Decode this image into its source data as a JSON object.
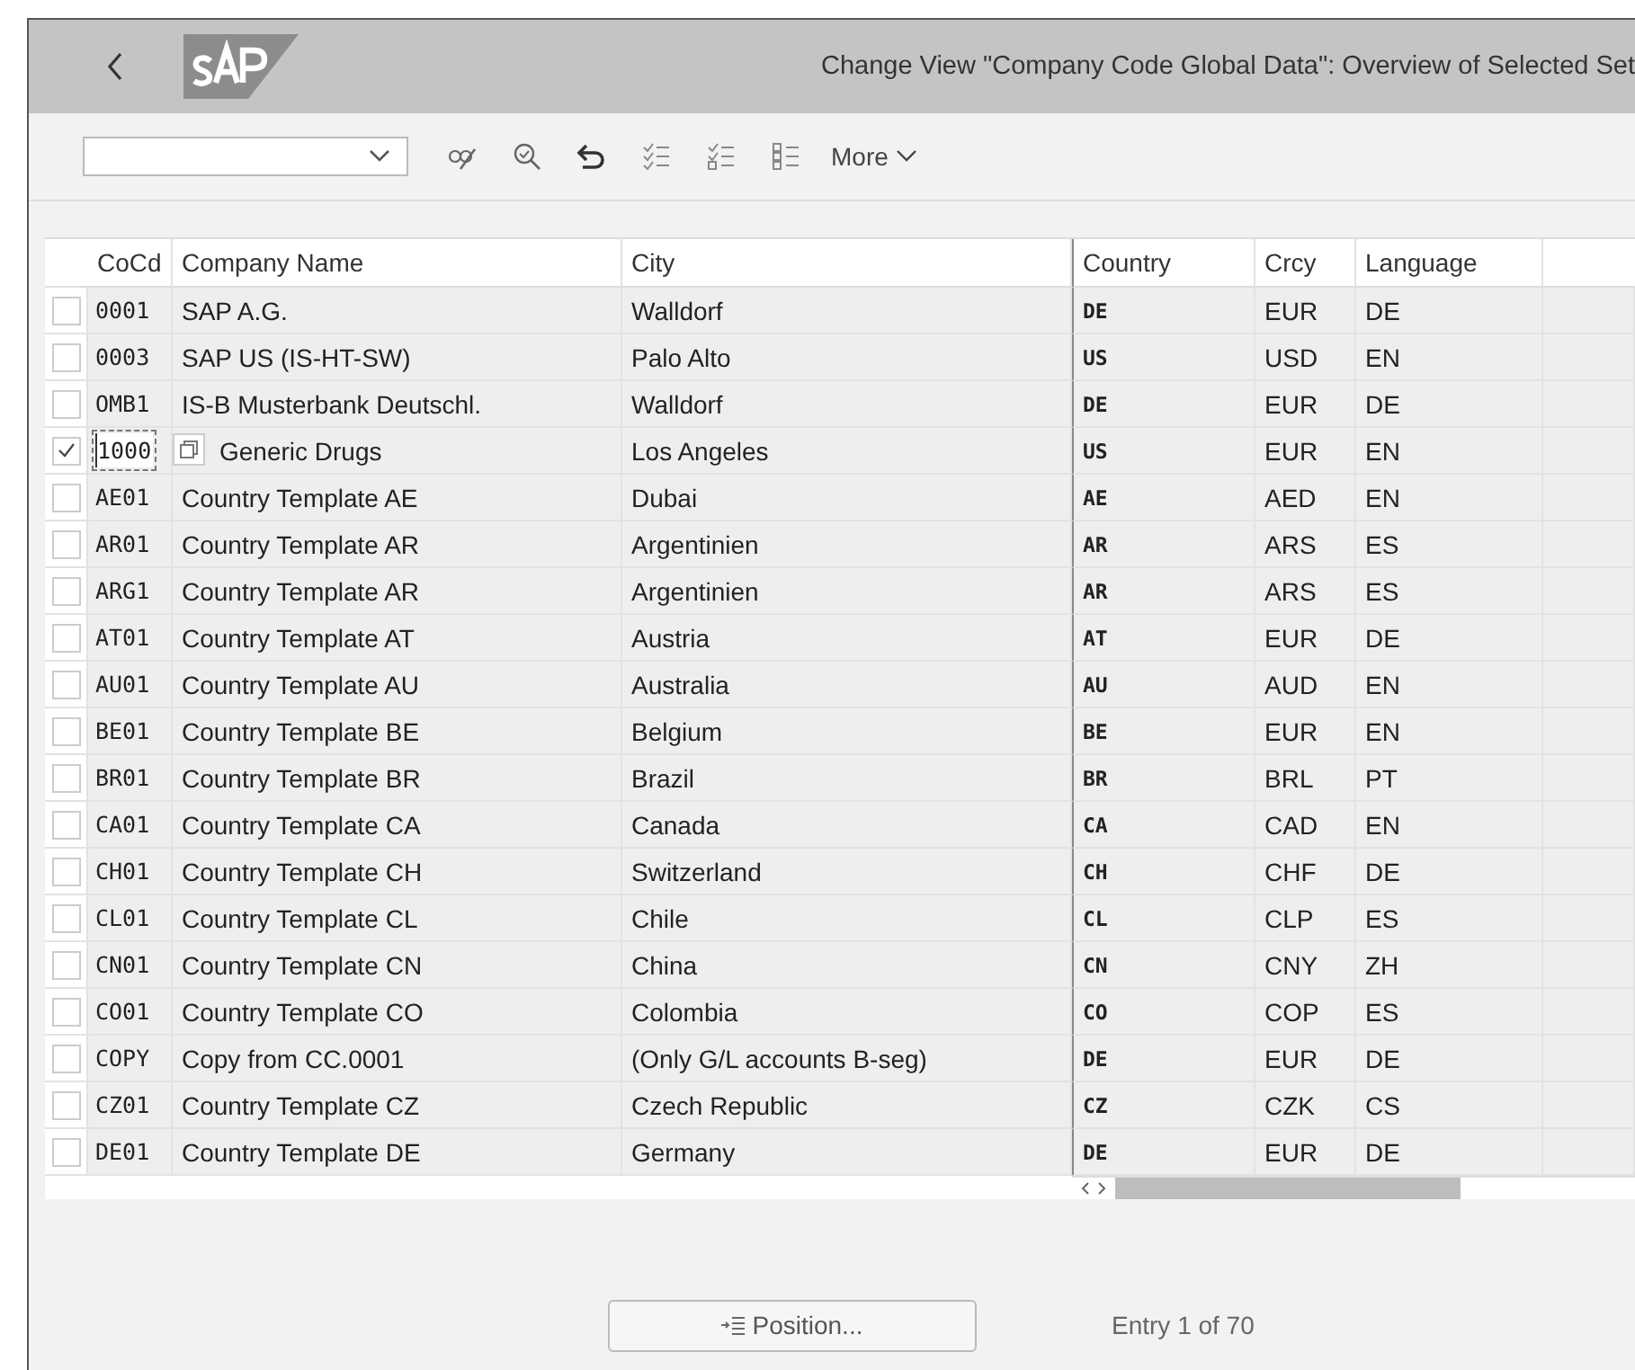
{
  "header": {
    "title": "Change View \"Company Code Global Data\": Overview of Selected Set"
  },
  "toolbar": {
    "more": "More"
  },
  "table": {
    "columns": [
      "CoCd",
      "Company Name",
      "City",
      "Country",
      "Crcy",
      "Language"
    ],
    "rows": [
      {
        "selected": false,
        "focused": false,
        "cells": [
          "0001",
          "SAP A.G.",
          "Walldorf",
          "DE",
          "EUR",
          "DE"
        ]
      },
      {
        "selected": false,
        "focused": false,
        "cells": [
          "0003",
          "SAP US (IS-HT-SW)",
          "Palo Alto",
          "US",
          "USD",
          "EN"
        ]
      },
      {
        "selected": false,
        "focused": false,
        "cells": [
          "OMB1",
          "IS-B Musterbank Deutschl.",
          "Walldorf",
          "DE",
          "EUR",
          "DE"
        ]
      },
      {
        "selected": true,
        "focused": true,
        "cells": [
          "1000",
          "Generic Drugs",
          "Los Angeles",
          "US",
          "EUR",
          "EN"
        ]
      },
      {
        "selected": false,
        "focused": false,
        "cells": [
          "AE01",
          "Country Template AE",
          "Dubai",
          "AE",
          "AED",
          "EN"
        ]
      },
      {
        "selected": false,
        "focused": false,
        "cells": [
          "AR01",
          "Country Template AR",
          "Argentinien",
          "AR",
          "ARS",
          "ES"
        ]
      },
      {
        "selected": false,
        "focused": false,
        "cells": [
          "ARG1",
          "Country Template AR",
          "Argentinien",
          "AR",
          "ARS",
          "ES"
        ]
      },
      {
        "selected": false,
        "focused": false,
        "cells": [
          "AT01",
          "Country Template AT",
          "Austria",
          "AT",
          "EUR",
          "DE"
        ]
      },
      {
        "selected": false,
        "focused": false,
        "cells": [
          "AU01",
          "Country Template AU",
          "Australia",
          "AU",
          "AUD",
          "EN"
        ]
      },
      {
        "selected": false,
        "focused": false,
        "cells": [
          "BE01",
          "Country Template BE",
          "Belgium",
          "BE",
          "EUR",
          "EN"
        ]
      },
      {
        "selected": false,
        "focused": false,
        "cells": [
          "BR01",
          "Country Template BR",
          "Brazil",
          "BR",
          "BRL",
          "PT"
        ]
      },
      {
        "selected": false,
        "focused": false,
        "cells": [
          "CA01",
          "Country Template CA",
          "Canada",
          "CA",
          "CAD",
          "EN"
        ]
      },
      {
        "selected": false,
        "focused": false,
        "cells": [
          "CH01",
          "Country Template CH",
          "Switzerland",
          "CH",
          "CHF",
          "DE"
        ]
      },
      {
        "selected": false,
        "focused": false,
        "cells": [
          "CL01",
          "Country Template CL",
          "Chile",
          "CL",
          "CLP",
          "ES"
        ]
      },
      {
        "selected": false,
        "focused": false,
        "cells": [
          "CN01",
          "Country Template CN",
          "China",
          "CN",
          "CNY",
          "ZH"
        ]
      },
      {
        "selected": false,
        "focused": false,
        "cells": [
          "CO01",
          "Country Template CO",
          "Colombia",
          "CO",
          "COP",
          "ES"
        ]
      },
      {
        "selected": false,
        "focused": false,
        "cells": [
          "COPY",
          "Copy from CC.0001",
          "(Only G/L accounts B-seg)",
          "DE",
          "EUR",
          "DE"
        ]
      },
      {
        "selected": false,
        "focused": false,
        "cells": [
          "CZ01",
          "Country Template CZ",
          "Czech Republic",
          "CZ",
          "CZK",
          "CS"
        ]
      },
      {
        "selected": false,
        "focused": false,
        "cells": [
          "DE01",
          "Country Template DE",
          "Germany",
          "DE",
          "EUR",
          "DE"
        ]
      }
    ]
  },
  "footer": {
    "position_button": "Position...",
    "entry": "Entry 1 of 70"
  }
}
